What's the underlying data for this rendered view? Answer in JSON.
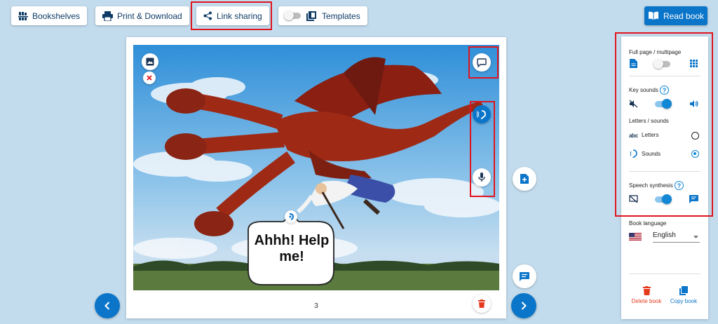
{
  "toolbar": {
    "bookshelves": "Bookshelves",
    "print_download": "Print & Download",
    "link_sharing": "Link sharing",
    "templates": "Templates",
    "read_book": "Read book"
  },
  "page": {
    "number": "3",
    "speech_bubble": "Ahhh! Help me!"
  },
  "panel": {
    "full_page_multipage": "Full page / multipage",
    "key_sounds": "Key sounds",
    "help_mark": "?",
    "letters_sounds": "Letters / sounds",
    "letters_prefix": "abc",
    "letters": "Letters",
    "sounds": "Sounds",
    "speech_synthesis": "Speech synthesis",
    "book_language_label": "Book language",
    "language": "English",
    "delete_book": "Delete book",
    "copy_book": "Copy book"
  },
  "state": {
    "templates_toggle": false,
    "multipage_toggle": false,
    "key_sounds_toggle": true,
    "letters_sounds_selected": "sounds",
    "speech_synthesis_toggle": true
  },
  "colors": {
    "accent": "#0b75c9",
    "toggle_on": "#1187d6",
    "highlight_box": "#e0141e",
    "delete": "#e53a1e",
    "background": "#c3dced"
  }
}
